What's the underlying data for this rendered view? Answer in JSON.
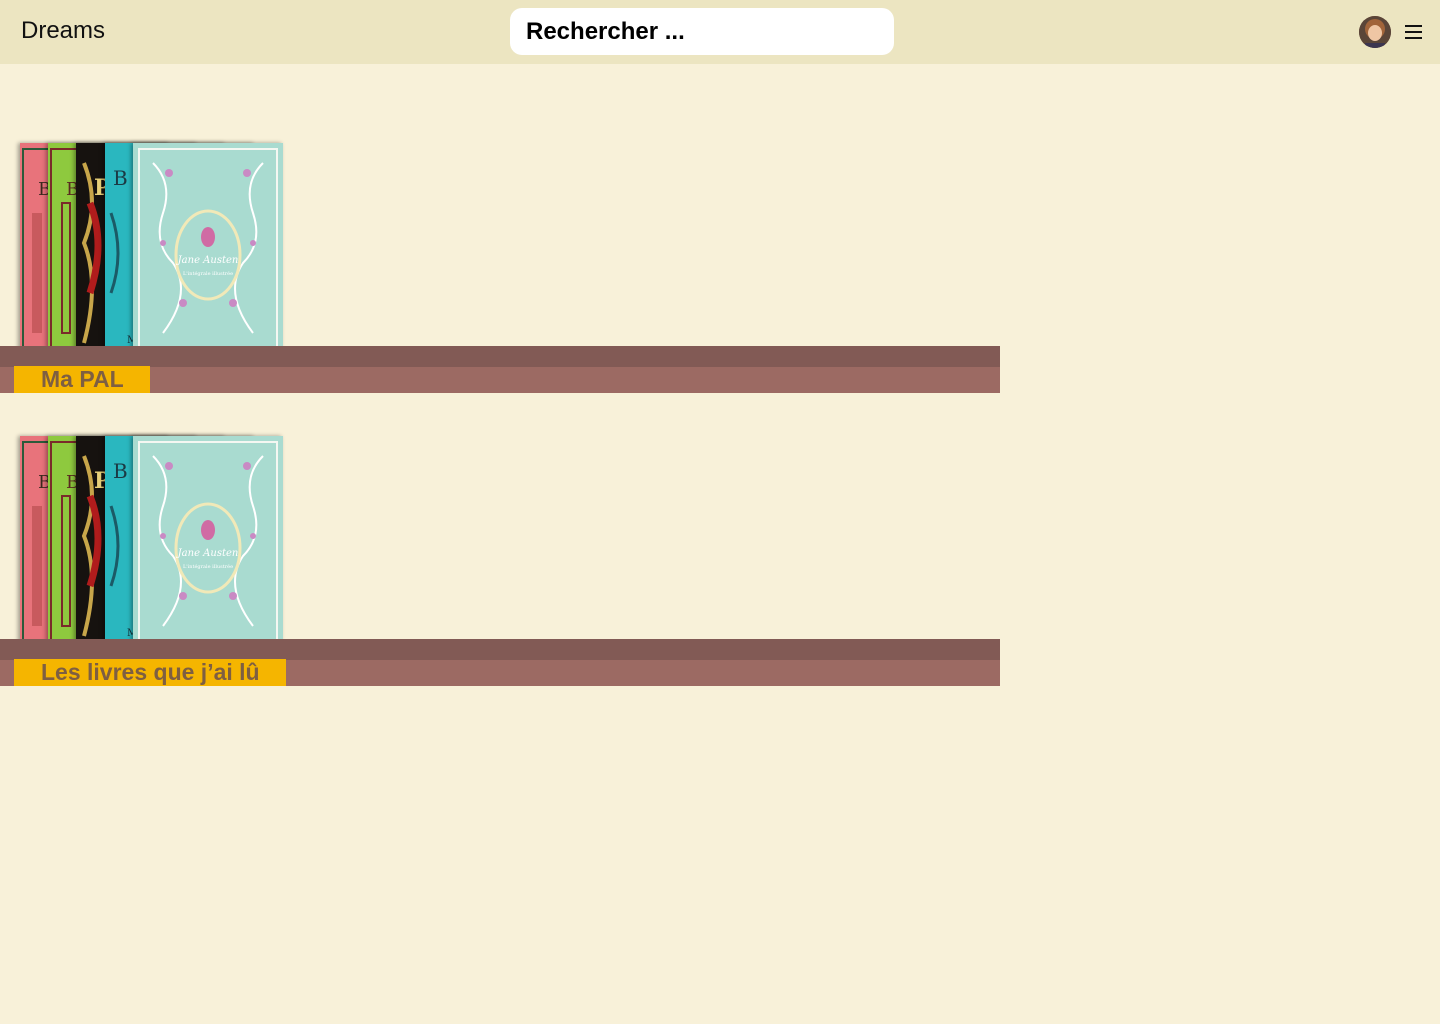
{
  "header": {
    "brand": "Dreams",
    "search_placeholder": "Rechercher ...",
    "avatar_icon": "user-avatar",
    "menu_icon": "hamburger-menu-icon"
  },
  "shelves": [
    {
      "label": "Ma PAL"
    },
    {
      "label": "Les livres que j’ai lû"
    }
  ],
  "featured_cover": {
    "author": "Jane Austen",
    "subtitle": "L'intégrale illustrée"
  },
  "colors": {
    "background": "#f8f1d9",
    "header": "#ece5c1",
    "plank_dark": "#825a55",
    "plank_light": "#9c6a63",
    "label_bg": "#f5b500",
    "label_text": "#7e5f42"
  }
}
